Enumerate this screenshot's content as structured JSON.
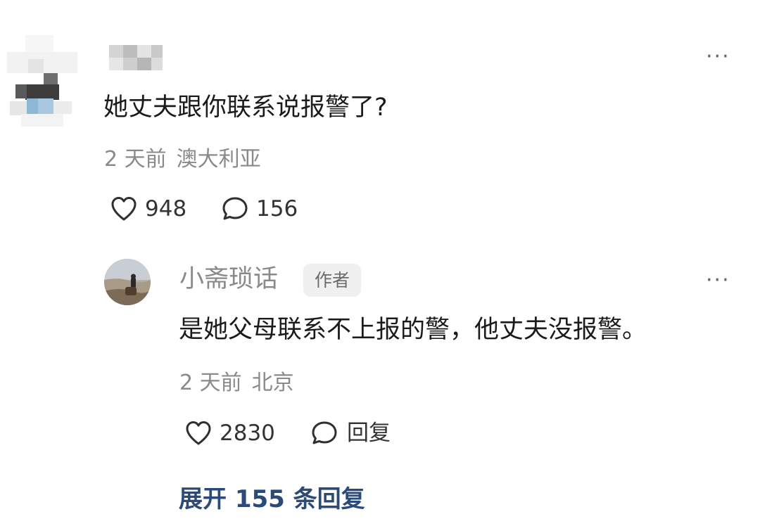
{
  "comment": {
    "text": "她丈夫跟你联系说报警了?",
    "time": "2 天前",
    "location": "澳大利亚",
    "likes": "948",
    "replies": "156"
  },
  "reply": {
    "username": "小斋琐话",
    "badge": "作者",
    "text": "是她父母联系不上报的警，他丈夫没报警。",
    "time": "2 天前",
    "location": "北京",
    "likes": "2830",
    "reply_label": "回复"
  },
  "expand_label": "展开 155 条回复",
  "more_label": "···",
  "icons": {
    "like": "heart-outline-icon",
    "comment": "speech-bubble-icon",
    "more": "more-dots-icon"
  },
  "colors": {
    "text": "#1b1b1b",
    "meta": "#8a8a8a",
    "link": "#2b4a78"
  }
}
